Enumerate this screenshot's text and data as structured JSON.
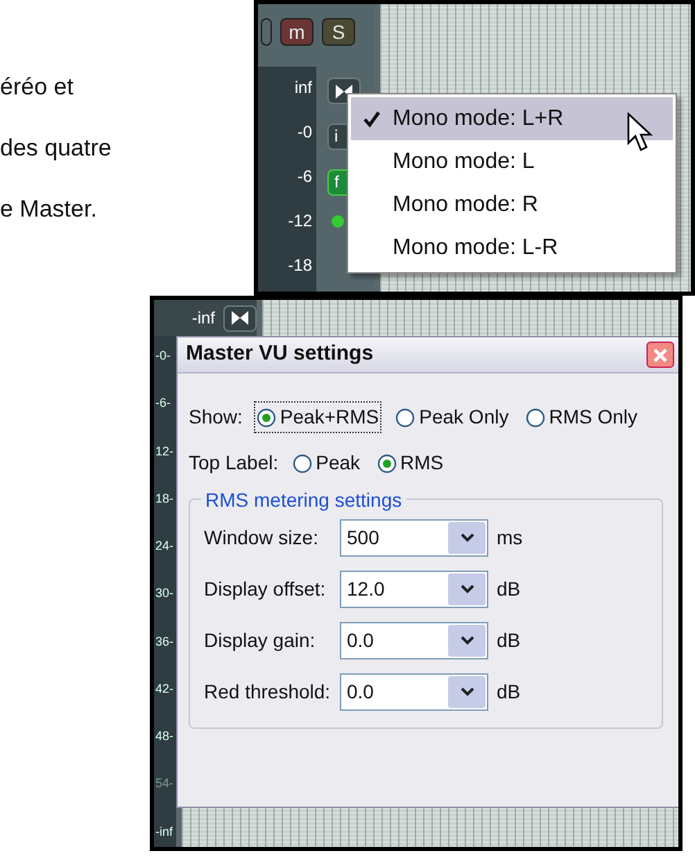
{
  "page_text": {
    "lines": [
      "éréo et",
      "des quatre",
      "e Master."
    ]
  },
  "top_screenshot": {
    "track_buttons": [
      "m",
      "S"
    ],
    "meter_labels": [
      "inf",
      "-0",
      "-6",
      "-12",
      "-18"
    ],
    "strip_buttons": [
      {
        "kind": "icon"
      },
      {
        "kind": "text",
        "label": "i"
      },
      {
        "kind": "fx",
        "label": "f"
      },
      {
        "kind": "led"
      }
    ],
    "context_menu": [
      {
        "label": "Mono mode: L+R",
        "checked": true,
        "selected": true
      },
      {
        "label": "Mono mode: L",
        "checked": false,
        "selected": false
      },
      {
        "label": "Mono mode: R",
        "checked": false,
        "selected": false
      },
      {
        "label": "Mono mode: L-R",
        "checked": false,
        "selected": false
      }
    ]
  },
  "bottom_screenshot": {
    "top_label": "-inf",
    "meter_labels": [
      "-0-",
      "-6-",
      "12-",
      "18-",
      "24-",
      "30-",
      "36-",
      "42-",
      "48-",
      "54-",
      "-inf"
    ],
    "dialog": {
      "title": "Master VU settings",
      "show": {
        "label": "Show:",
        "options": [
          {
            "label": "Peak+RMS",
            "selected": true,
            "focused": true
          },
          {
            "label": "Peak Only",
            "selected": false,
            "focused": false
          },
          {
            "label": "RMS Only",
            "selected": false,
            "focused": false
          }
        ]
      },
      "top_label": {
        "label": "Top Label:",
        "options": [
          {
            "label": "Peak",
            "selected": false
          },
          {
            "label": "RMS",
            "selected": true
          }
        ]
      },
      "group": {
        "title": "RMS metering settings",
        "rows": [
          {
            "label": "Window size:",
            "value": "500",
            "unit": "ms"
          },
          {
            "label": "Display offset:",
            "value": "12.0",
            "unit": "dB"
          },
          {
            "label": "Display gain:",
            "value": "0.0",
            "unit": "dB"
          },
          {
            "label": "Red threshold:",
            "value": "0.0",
            "unit": "dB"
          }
        ]
      }
    }
  }
}
